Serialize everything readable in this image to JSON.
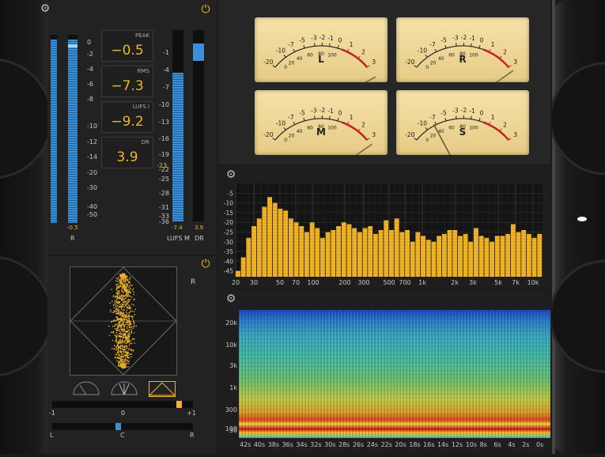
{
  "level_meter": {
    "scale": [
      "0",
      "-2",
      "-4",
      "-6",
      "-8",
      "-10",
      "-12",
      "-14",
      "-20",
      "-30",
      "-40",
      "-50"
    ],
    "readout": "-0.5",
    "channel_label": "R",
    "peak": {
      "label": "PEAK",
      "value": "−0.5"
    },
    "rms": {
      "label": "RMS",
      "value": "−7.3"
    },
    "lufs_i": {
      "label": "LUFS I",
      "value": "−9.2"
    },
    "dr": {
      "label": "DR",
      "value": "3.9"
    }
  },
  "loudness_meter": {
    "scale": [
      "-1",
      "-4",
      "-7",
      "-10",
      "-13",
      "-16",
      "-19",
      "-22",
      "-25",
      "-28",
      "-31",
      "-33",
      "-36"
    ],
    "target_marker": "-23",
    "lufs_m_value": "-7.4",
    "dr_value": "3.9",
    "lufs_m_label": "LUFS M",
    "dr_label": "DR"
  },
  "vu_meters": {
    "scale_black": [
      "-20",
      "-10",
      "-7",
      "-5",
      "-3",
      "-2",
      "-1",
      "0"
    ],
    "scale_red": [
      "1",
      "2",
      "3"
    ],
    "scale_inner": [
      "0",
      "20",
      "40",
      "60",
      "80",
      "100"
    ],
    "meters": [
      {
        "name": "L"
      },
      {
        "name": "R"
      },
      {
        "name": "M"
      },
      {
        "name": "S"
      }
    ]
  },
  "spectrum": {
    "y_ticks": [
      "-5",
      "-10",
      "-15",
      "-20",
      "-25",
      "-30",
      "-35",
      "-40",
      "-45"
    ],
    "x_ticks": [
      "20",
      "30",
      "50",
      "70",
      "100",
      "200",
      "300",
      "500",
      "700",
      "1k",
      "2k",
      "3k",
      "5k",
      "7k",
      "10k"
    ],
    "bars_db": [
      -45,
      -38,
      -28,
      -22,
      -18,
      -12,
      -7,
      -10,
      -13,
      -14,
      -18,
      -20,
      -22,
      -25,
      -20,
      -23,
      -28,
      -25,
      -24,
      -22,
      -20,
      -21,
      -23,
      -25,
      -23,
      -22,
      -26,
      -24,
      -19,
      -24,
      -18,
      -25,
      -24,
      -30,
      -25,
      -27,
      -29,
      -30,
      -27,
      -26,
      -24,
      -24,
      -27,
      -26,
      -30,
      -23,
      -27,
      -28,
      -30,
      -27,
      -27,
      -26,
      -21,
      -25,
      -24,
      -26,
      -28,
      -26
    ]
  },
  "spectrogram": {
    "y_ticks": [
      "20k",
      "10k",
      "3k",
      "1k",
      "300",
      "100",
      "30"
    ],
    "x_ticks": [
      "42s",
      "40s",
      "38s",
      "36s",
      "34s",
      "32s",
      "30s",
      "28s",
      "26s",
      "24s",
      "22s",
      "20s",
      "18s",
      "16s",
      "14s",
      "12s",
      "10s",
      "8s",
      "6s",
      "4s",
      "2s",
      "0s"
    ]
  },
  "stereo": {
    "r_label": "R",
    "balance_scale": [
      "-1",
      "0",
      "+1"
    ],
    "balance_value": 0.92,
    "pan_scale": [
      "L",
      "C",
      "R"
    ],
    "pan_value": 0.47
  },
  "colors": {
    "accent": "#f0b429",
    "meter_blue": "#3a8fd6",
    "panel": "#222222",
    "vu_face": "#f0dca0"
  }
}
